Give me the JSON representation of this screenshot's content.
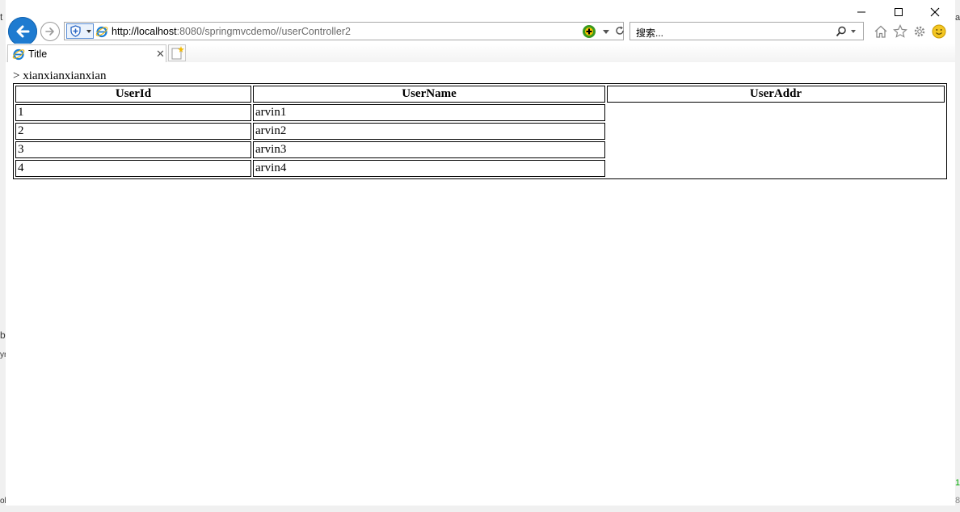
{
  "window": {
    "controls": [
      "minimize",
      "maximize",
      "close"
    ]
  },
  "nav": {
    "address_host": "http://localhost",
    "address_rest": ":8080/springmvcdemo//userController2",
    "search_placeholder": "搜索..."
  },
  "tabs": [
    {
      "title": "Title"
    }
  ],
  "page": {
    "heading": "> xianxianxianxian",
    "table": {
      "headers": [
        "UserId",
        "UserName",
        "UserAddr"
      ],
      "rows": [
        {
          "id": "1",
          "name": "arvin1",
          "addr": ""
        },
        {
          "id": "2",
          "name": "arvin2",
          "addr": ""
        },
        {
          "id": "3",
          "name": "arvin3",
          "addr": ""
        },
        {
          "id": "4",
          "name": "arvin4",
          "addr": ""
        }
      ]
    }
  },
  "background_fragments": {
    "left": [
      "t",
      "b",
      "yr",
      "ol"
    ],
    "right": [
      "an",
      "1",
      "8"
    ]
  },
  "colors": {
    "back_button": "#1e7bd0",
    "compat_border": "#5a8ed6"
  }
}
